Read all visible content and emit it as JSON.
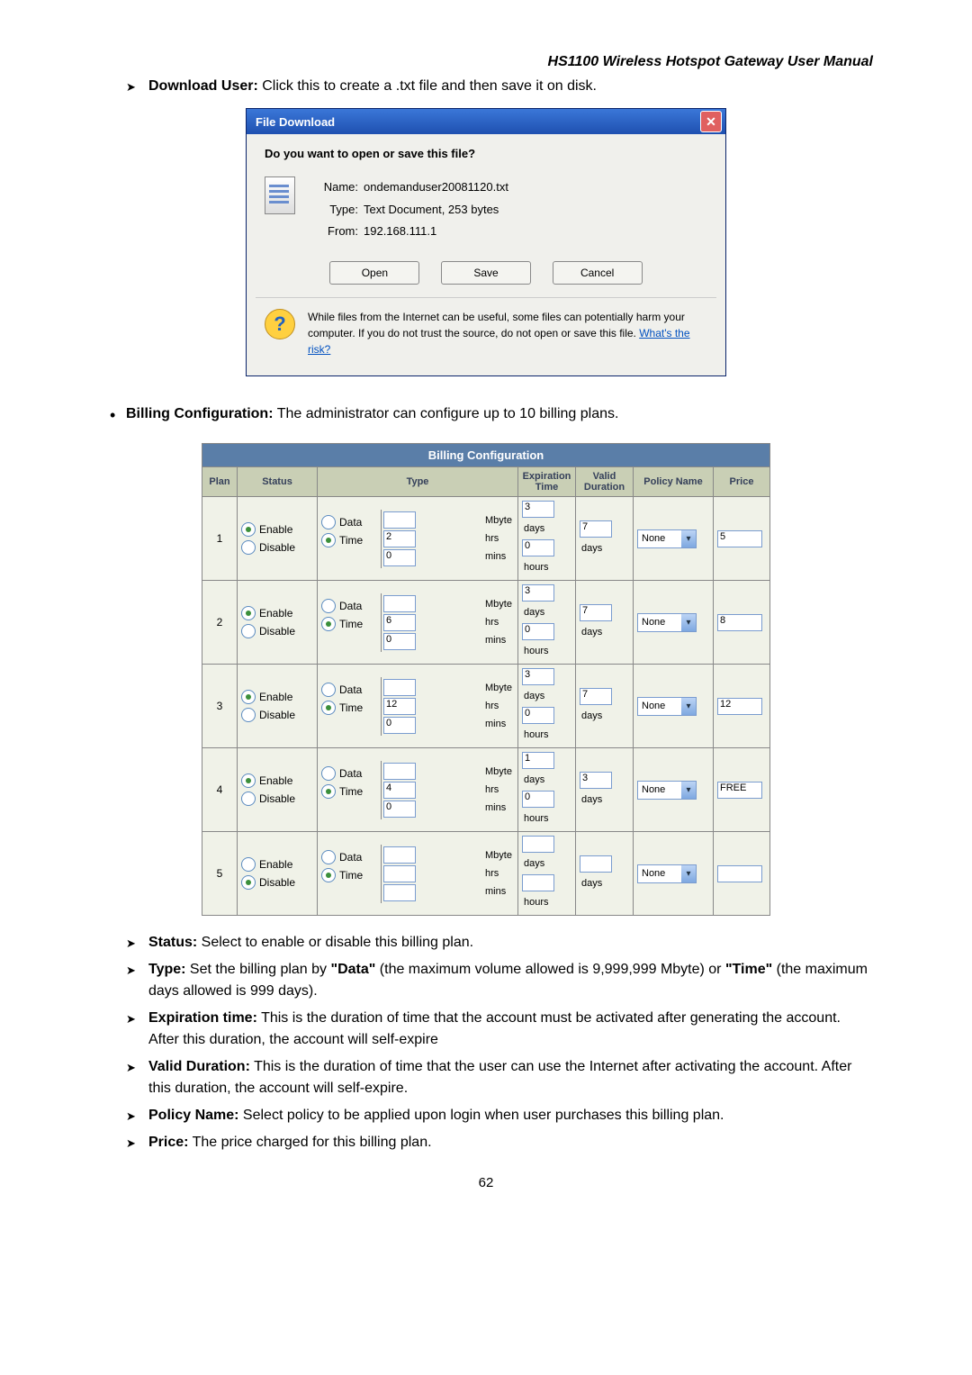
{
  "header_title": "HS1100 Wireless Hotspot Gateway User Manual",
  "download_user": {
    "label": "Download User:",
    "text": " Click this to create a .txt file and then save it on disk."
  },
  "file_dialog": {
    "title": "File Download",
    "prompt": "Do you want to open or save this file?",
    "name_label": "Name:",
    "name_value": "ondemanduser20081120.txt",
    "type_label": "Type:",
    "type_value": "Text Document, 253 bytes",
    "from_label": "From:",
    "from_value": "192.168.111.1",
    "open": "Open",
    "save": "Save",
    "cancel": "Cancel",
    "warn": "While files from the Internet can be useful, some files can potentially harm your computer. If you do not trust the source, do not open or save this file. ",
    "warn_link": "What's the risk?"
  },
  "billing_intro": {
    "label": "Billing Configuration:",
    "text": " The administrator can configure up to 10 billing plans."
  },
  "billing": {
    "title": "Billing Configuration",
    "headers": {
      "plan": "Plan",
      "status": "Status",
      "type": "Type",
      "expiration": "Expiration Time",
      "valid": "Valid Duration",
      "policy": "Policy Name",
      "price": "Price"
    },
    "labels": {
      "enable": "Enable",
      "disable": "Disable",
      "data": "Data",
      "time": "Time",
      "mbyte": "Mbyte",
      "hrs": "hrs",
      "mins": "mins",
      "days": "days",
      "hours": "hours",
      "none": "None"
    },
    "rows": [
      {
        "plan": "1",
        "status": "Enable",
        "type": "Time",
        "hrs": "2",
        "mins": "0",
        "exp_days": "3",
        "exp_hours": "0",
        "valid_days": "7",
        "policy": "None",
        "price": "5"
      },
      {
        "plan": "2",
        "status": "Enable",
        "type": "Time",
        "hrs": "6",
        "mins": "0",
        "exp_days": "3",
        "exp_hours": "0",
        "valid_days": "7",
        "policy": "None",
        "price": "8"
      },
      {
        "plan": "3",
        "status": "Enable",
        "type": "Time",
        "hrs": "12",
        "mins": "0",
        "exp_days": "3",
        "exp_hours": "0",
        "valid_days": "7",
        "policy": "None",
        "price": "12"
      },
      {
        "plan": "4",
        "status": "Enable",
        "type": "Time",
        "hrs": "4",
        "mins": "0",
        "exp_days": "1",
        "exp_hours": "0",
        "valid_days": "3",
        "policy": "None",
        "price": "FREE"
      },
      {
        "plan": "5",
        "status": "Disable",
        "type": "Time",
        "hrs": "",
        "mins": "",
        "exp_days": "",
        "exp_hours": "",
        "valid_days": "",
        "policy": "None",
        "price": ""
      }
    ]
  },
  "notes": {
    "status": {
      "label": "Status:",
      "text": " Select to enable or disable this billing plan."
    },
    "type": {
      "label": "Type:",
      "text_a": " Set the billing plan by ",
      "data": "\"Data\"",
      "text_b": " (the maximum volume allowed is 9,999,999 Mbyte) or ",
      "time": "\"Time\"",
      "text_c": " (the maximum days allowed is 999 days)."
    },
    "expiration": {
      "label": "Expiration time:",
      "text": " This is the duration of time that the account must be activated after generating the account. After this duration, the account will self-expire"
    },
    "valid": {
      "label": "Valid Duration:",
      "text": " This is the duration of time that the user can use the Internet after activating the account. After this duration, the account will self-expire."
    },
    "policy": {
      "label": "Policy Name:",
      "text": " Select policy to be applied upon login when user purchases this billing plan."
    },
    "price": {
      "label": "Price:",
      "text": " The price charged for this billing plan."
    }
  },
  "page_number": "62"
}
